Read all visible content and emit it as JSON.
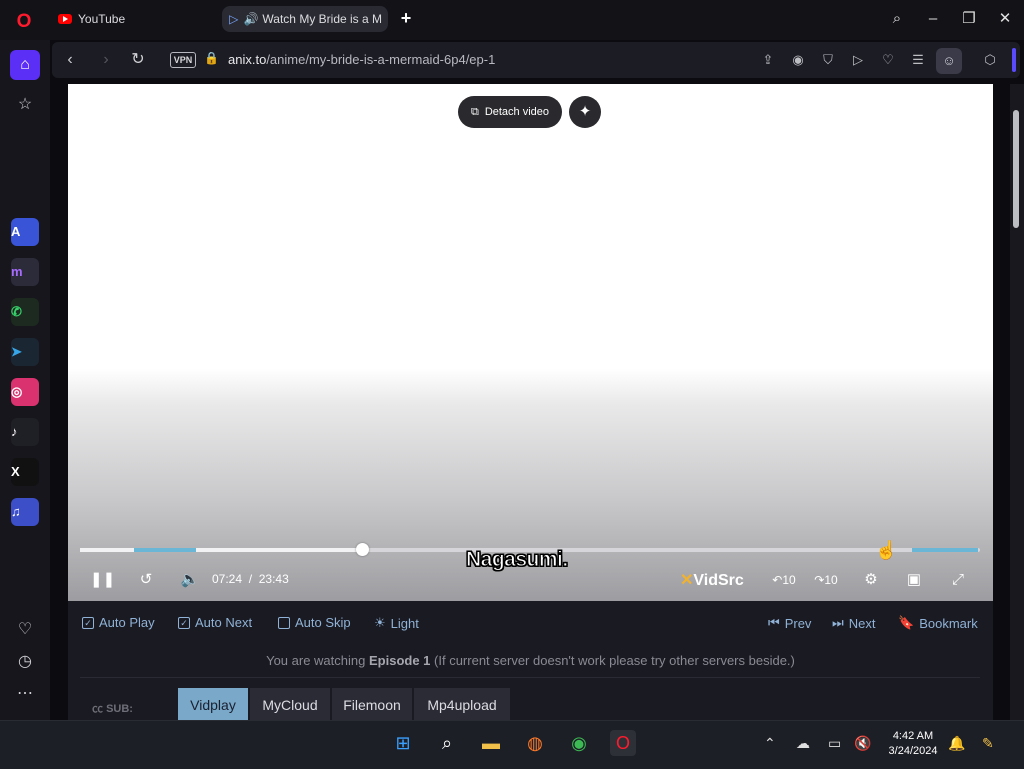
{
  "tabs": [
    {
      "title": "YouTube"
    },
    {
      "title": "Watch My Bride is a M"
    }
  ],
  "address": {
    "vpn": "VPN",
    "domain": "anix.to",
    "path": "/anime/my-bride-is-a-mermaid-6p4/ep-1"
  },
  "video": {
    "detach_label": "Detach video",
    "subtitle": "Nagasumi.",
    "current_time": "07:24",
    "separator": "/",
    "duration": "23:43",
    "progress_fraction": 0.313,
    "provider": "VidSrc",
    "skip_back_label": "10",
    "skip_fwd_label": "10"
  },
  "options": {
    "auto_play": "Auto Play",
    "auto_next": "Auto Next",
    "auto_skip": "Auto Skip",
    "light": "Light",
    "prev": "Prev",
    "next": "Next",
    "bookmark": "Bookmark"
  },
  "watching": {
    "prefix": "You are watching",
    "episode": "Episode 1",
    "suffix": "(If current server doesn't work please try other servers beside.)"
  },
  "servers": {
    "label": "SUB:",
    "items": [
      "Vidplay",
      "MyCloud",
      "Filemoon",
      "Mp4upload"
    ],
    "active": "Vidplay"
  },
  "taskbar": {
    "time": "4:42 AM",
    "date": "3/24/2024"
  },
  "colors": {
    "accent": "#5b2ff5",
    "link": "#8fb2d6",
    "active_server": "#7aa8c8"
  }
}
